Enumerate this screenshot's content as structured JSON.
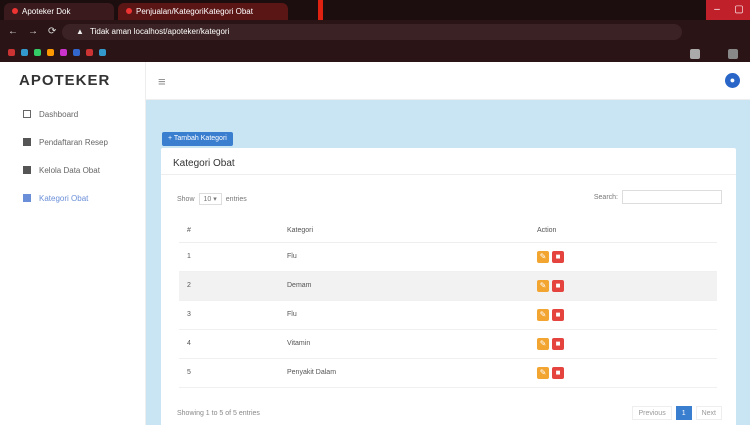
{
  "browser": {
    "tabs": [
      {
        "title": "Apoteker Dok"
      },
      {
        "title": "Penjualan/KategoriKategori Obat"
      }
    ],
    "url_warning": "Tidak aman",
    "url": "localhost/apoteker/kategori"
  },
  "app": {
    "brand": "APOTEKER",
    "menu": [
      {
        "label": "Dashboard",
        "icon": "monitor-icon"
      },
      {
        "label": "Pendaftaran Resep",
        "icon": "file-icon"
      },
      {
        "label": "Kelola Data Obat",
        "icon": "table-icon"
      },
      {
        "label": "Kategori Obat",
        "icon": "table-icon"
      }
    ]
  },
  "page": {
    "add_button": "+ Tambah Kategori",
    "card_title": "Kategori Obat",
    "show_label": "Show",
    "show_value": "10",
    "entries_label": "entries",
    "search_label": "Search:",
    "columns": [
      "#",
      "Kategori",
      "Action"
    ],
    "rows": [
      {
        "no": "1",
        "kategori": "Flu"
      },
      {
        "no": "2",
        "kategori": "Demam"
      },
      {
        "no": "3",
        "kategori": "Flu"
      },
      {
        "no": "4",
        "kategori": "Vitamin"
      },
      {
        "no": "5",
        "kategori": "Penyakit Dalam"
      }
    ],
    "info": "Showing 1 to 5 of 5 entries",
    "pager": {
      "prev": "Previous",
      "current": "1",
      "next": "Next"
    }
  },
  "colors": {
    "accent": "#3a7ed0",
    "edit": "#f2a531",
    "delete": "#e5433d",
    "content_bg": "#c9e4f2"
  }
}
